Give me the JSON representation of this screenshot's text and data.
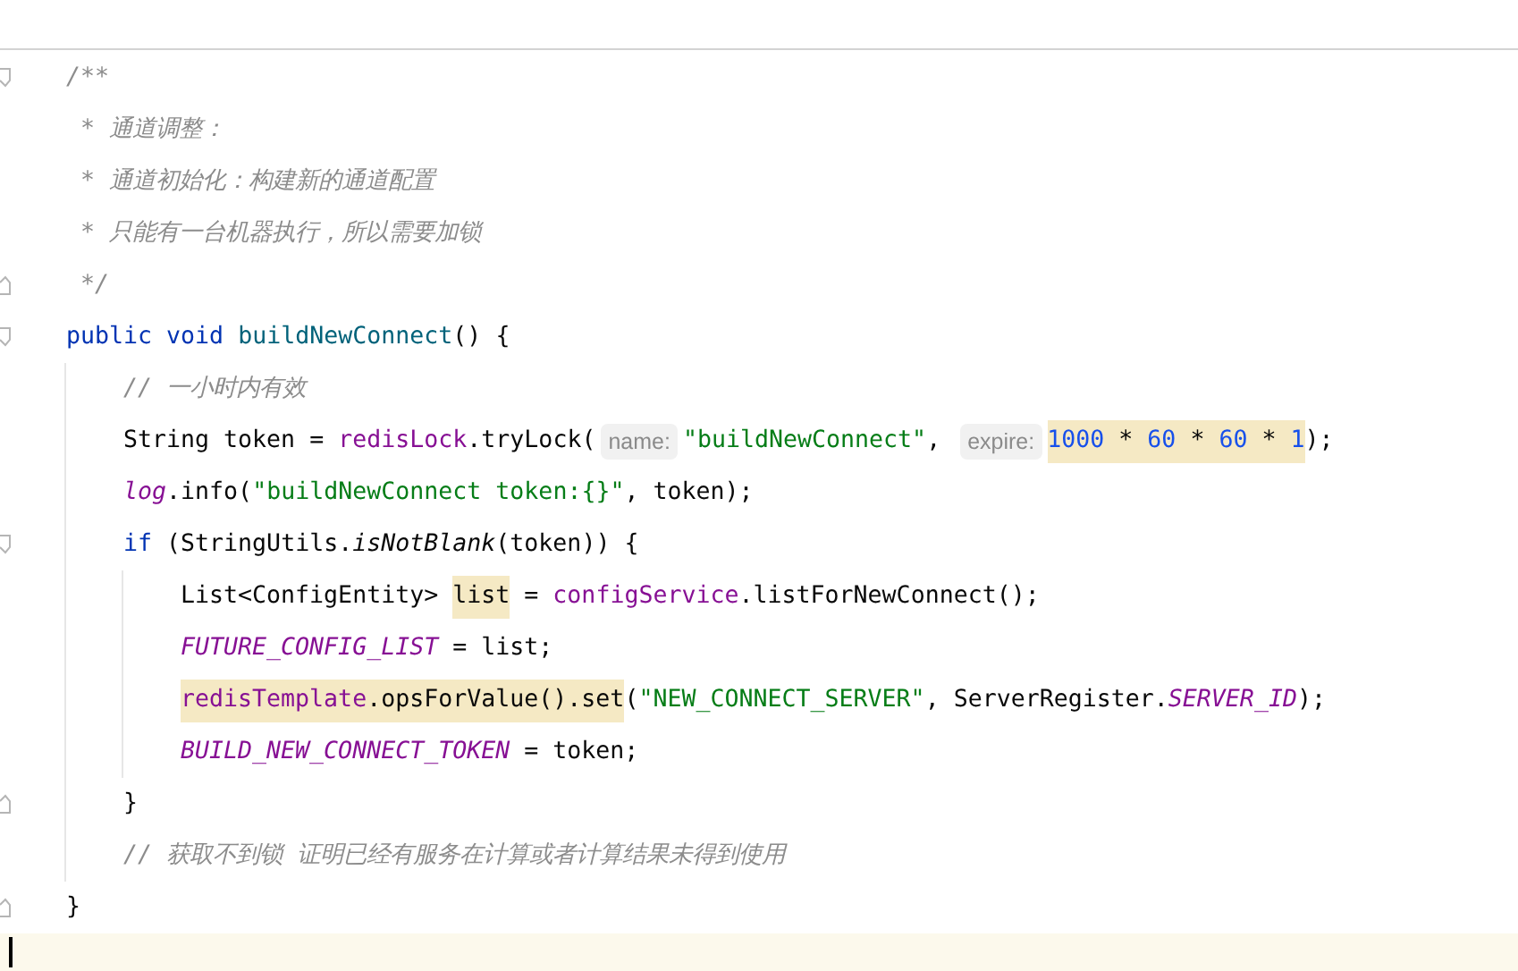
{
  "editor": {
    "lines": [
      {
        "fold_start": true,
        "current": false,
        "tokens": [
          {
            "kind": "comment",
            "text": "/**"
          }
        ]
      },
      {
        "current": false,
        "tokens": [
          {
            "kind": "comment",
            "text": " * 通道调整："
          }
        ]
      },
      {
        "current": false,
        "tokens": [
          {
            "kind": "comment",
            "text": " * 通道初始化：构建新的通道配置"
          }
        ]
      },
      {
        "current": false,
        "tokens": [
          {
            "kind": "comment",
            "text": " * 只能有一台机器执行，所以需要加锁"
          }
        ]
      },
      {
        "fold_end": true,
        "current": false,
        "tokens": [
          {
            "kind": "comment",
            "text": " */"
          }
        ]
      },
      {
        "fold_start": true,
        "current": false,
        "tokens": [
          {
            "kind": "keyword",
            "text": "public void "
          },
          {
            "kind": "decl",
            "text": "buildNewConnect"
          },
          {
            "kind": "plain",
            "text": "() {"
          }
        ],
        "children": [
          {
            "current": false,
            "tokens": [
              {
                "kind": "comment",
                "text": "// 一小时内有效"
              }
            ]
          },
          {
            "current": false,
            "tokens": [
              {
                "kind": "plain",
                "text": "String token = "
              },
              {
                "kind": "field",
                "text": "redisLock"
              },
              {
                "kind": "plain",
                "text": ".tryLock("
              },
              {
                "kind": "hint",
                "text": "name:"
              },
              {
                "kind": "string",
                "text": "\"buildNewConnect\""
              },
              {
                "kind": "plain",
                "text": ", "
              },
              {
                "kind": "hint",
                "text": "expire:"
              },
              {
                "kind": "highlight",
                "tokens": [
                  {
                    "kind": "number",
                    "text": "1000"
                  },
                  {
                    "kind": "plain",
                    "text": " * "
                  },
                  {
                    "kind": "number",
                    "text": "60"
                  },
                  {
                    "kind": "plain",
                    "text": " * "
                  },
                  {
                    "kind": "number",
                    "text": "60"
                  },
                  {
                    "kind": "plain",
                    "text": " * "
                  },
                  {
                    "kind": "number",
                    "text": "1"
                  }
                ]
              },
              {
                "kind": "plain",
                "text": ");"
              }
            ]
          },
          {
            "current": false,
            "tokens": [
              {
                "kind": "static",
                "text": "log"
              },
              {
                "kind": "plain",
                "text": ".info("
              },
              {
                "kind": "string",
                "text": "\"buildNewConnect token:{}\""
              },
              {
                "kind": "plain",
                "text": ", token);"
              }
            ]
          },
          {
            "fold_start": true,
            "current": false,
            "tokens": [
              {
                "kind": "keyword",
                "text": "if"
              },
              {
                "kind": "plain",
                "text": " (StringUtils."
              },
              {
                "kind": "italic",
                "text": "isNotBlank"
              },
              {
                "kind": "plain",
                "text": "(token)) {"
              }
            ],
            "children": [
              {
                "current": false,
                "tokens": [
                  {
                    "kind": "plain",
                    "text": "List<ConfigEntity> "
                  },
                  {
                    "kind": "highlight",
                    "tokens": [
                      {
                        "kind": "plain",
                        "text": "list"
                      }
                    ]
                  },
                  {
                    "kind": "plain",
                    "text": " = "
                  },
                  {
                    "kind": "field",
                    "text": "configService"
                  },
                  {
                    "kind": "plain",
                    "text": ".listForNewConnect();"
                  }
                ]
              },
              {
                "current": false,
                "tokens": [
                  {
                    "kind": "static",
                    "text": "FUTURE_CONFIG_LIST"
                  },
                  {
                    "kind": "plain",
                    "text": " = list;"
                  }
                ]
              },
              {
                "current": false,
                "tokens": [
                  {
                    "kind": "highlight",
                    "tokens": [
                      {
                        "kind": "field",
                        "text": "redisTemplate"
                      },
                      {
                        "kind": "plain",
                        "text": ".opsForValue().set"
                      }
                    ]
                  },
                  {
                    "kind": "plain",
                    "text": "("
                  },
                  {
                    "kind": "string",
                    "text": "\"NEW_CONNECT_SERVER\""
                  },
                  {
                    "kind": "plain",
                    "text": ", ServerRegister."
                  },
                  {
                    "kind": "static",
                    "text": "SERVER_ID"
                  },
                  {
                    "kind": "plain",
                    "text": ");"
                  }
                ]
              },
              {
                "current": false,
                "tokens": [
                  {
                    "kind": "static",
                    "text": "BUILD_NEW_CONNECT_TOKEN"
                  },
                  {
                    "kind": "plain",
                    "text": " = token;"
                  }
                ]
              }
            ]
          },
          {
            "fold_end": true,
            "current": false,
            "tokens": [
              {
                "kind": "plain",
                "text": "}"
              }
            ]
          },
          {
            "current": false,
            "tokens": [
              {
                "kind": "comment",
                "text": "// 获取不到锁 证明已经有服务在计算或者计算结果未得到使用"
              }
            ]
          }
        ]
      },
      {
        "fold_end": true,
        "current": false,
        "tokens": [
          {
            "kind": "plain",
            "text": "}"
          }
        ]
      },
      {
        "current": true
      }
    ]
  }
}
